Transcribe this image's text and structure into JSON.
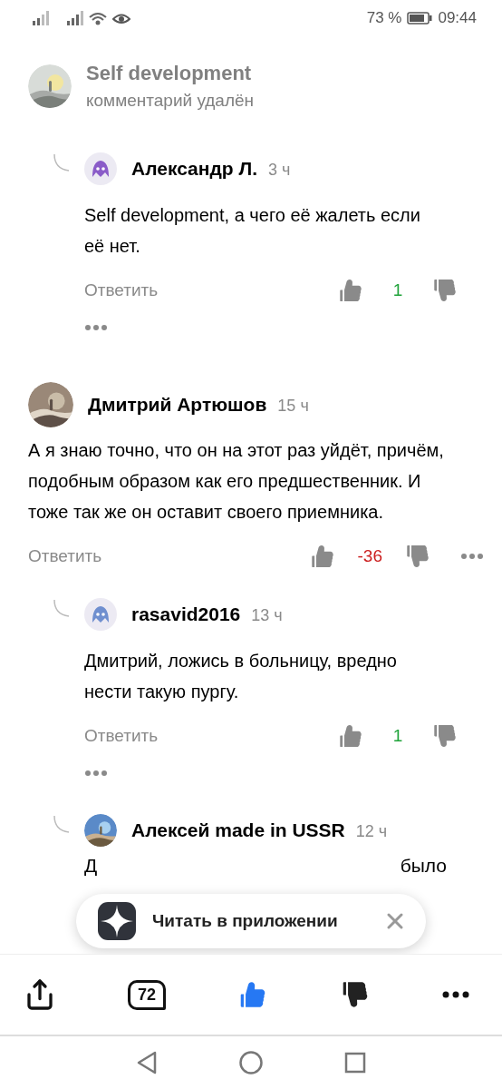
{
  "status_bar": {
    "battery": "73 %",
    "time": "09:44"
  },
  "comments": [
    {
      "kind": "deleted",
      "author": "Self development",
      "note": "комментарий удалён",
      "avatar": {
        "kind": "picture"
      },
      "children": [
        {
          "kind": "comment",
          "author": "Александр Л.",
          "time": "3 ч",
          "text": "Self development, а чего её жалеть если её нет.",
          "reply": "Ответить",
          "score": "1",
          "color": "#1fa33a",
          "avatar": {
            "kind": "mascot",
            "color": "#8a5cc8"
          }
        }
      ]
    },
    {
      "kind": "comment",
      "author": "Дмитрий Артюшов",
      "time": "15 ч",
      "text": "А я знаю точно, что он на этот раз уйдёт, причём, подобным образом как его предшественник. И тоже так же он оставит своего приемника.",
      "reply": "Ответить",
      "score": "-36",
      "color": "#cc1f1f",
      "avatar": {
        "kind": "picture"
      },
      "children": [
        {
          "kind": "comment",
          "author": "rasavid2016",
          "time": "13 ч",
          "text": "Дмитрий, ложись в больницу, вредно нести такую пургу.",
          "reply": "Ответить",
          "score": "1",
          "color": "#1fa33a",
          "avatar": {
            "kind": "mascot",
            "color": "#6f8fcf"
          }
        },
        {
          "kind": "partial",
          "author": "Алексей made in USSR",
          "time": "12 ч",
          "fragments": [
            "Д",
            "было"
          ],
          "avatar": {
            "kind": "picture"
          }
        }
      ]
    }
  ],
  "banner": {
    "label": "Читать в приложении"
  },
  "toolbar": {
    "comments": "72",
    "liked": true,
    "disliked": false
  }
}
